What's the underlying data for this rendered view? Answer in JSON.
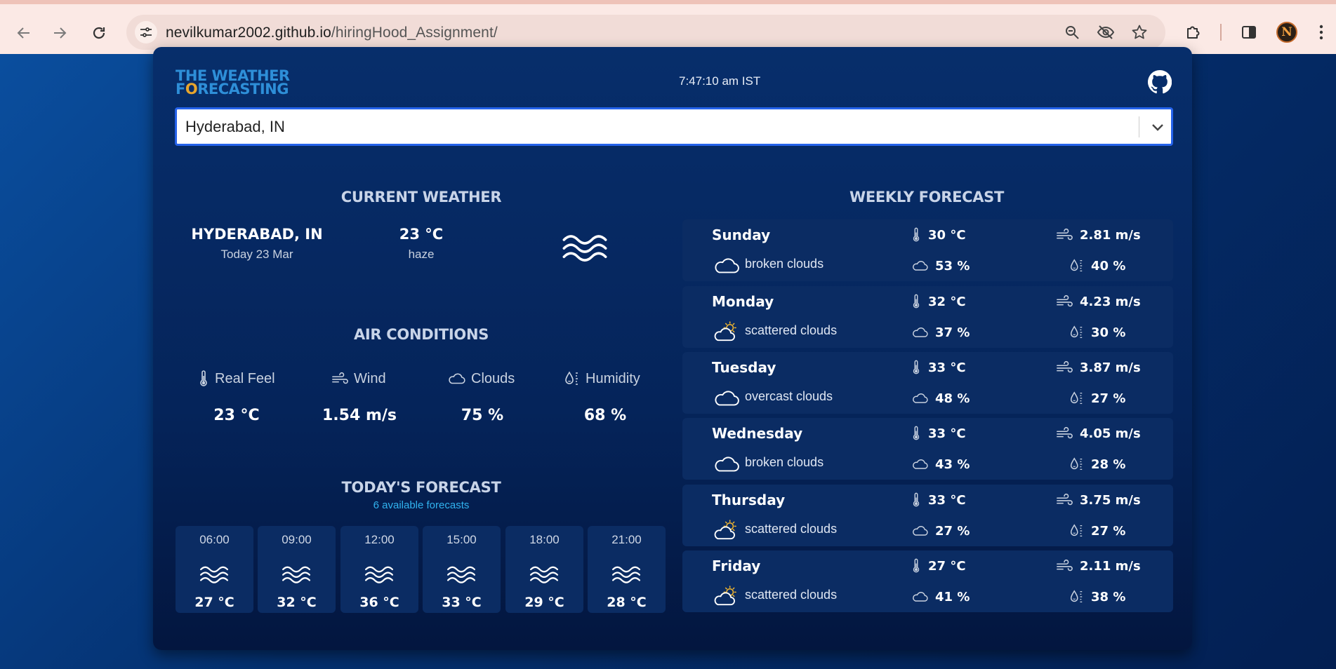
{
  "browser": {
    "url_host": "nevilkumar2002.github.io",
    "url_path": "/hiringHood_Assignment/",
    "avatar_letter": "N",
    "icons": [
      "back-icon",
      "forward-icon",
      "reload-icon",
      "site-info-icon",
      "zoom-icon",
      "eye-off-icon",
      "bookmark-star-icon",
      "extensions-icon",
      "sidebar-icon",
      "more-icon"
    ]
  },
  "header": {
    "logo_line1": "THE WEATHER",
    "logo_line2_f": "F",
    "logo_line2_o": "O",
    "logo_line2_rest": "RECASTING",
    "clock": "7:47:10 am IST"
  },
  "search": {
    "value": "Hyderabad, IN"
  },
  "current": {
    "title": "CURRENT WEATHER",
    "city": "HYDERABAD, IN",
    "date": "Today 23 Mar",
    "temp": "23 °C",
    "desc": "haze",
    "icon": "haze-icon"
  },
  "air": {
    "title": "AIR CONDITIONS",
    "items": [
      {
        "label": "Real Feel",
        "value": "23 °C",
        "icon": "thermometer-icon"
      },
      {
        "label": "Wind",
        "value": "1.54 m/s",
        "icon": "wind-icon"
      },
      {
        "label": "Clouds",
        "value": "75 %",
        "icon": "cloud-icon"
      },
      {
        "label": "Humidity",
        "value": "68 %",
        "icon": "humidity-icon"
      }
    ]
  },
  "today": {
    "title": "TODAY'S FORECAST",
    "subtitle": "6 available forecasts",
    "items": [
      {
        "time": "06:00",
        "temp": "27 °C"
      },
      {
        "time": "09:00",
        "temp": "32 °C"
      },
      {
        "time": "12:00",
        "temp": "36 °C"
      },
      {
        "time": "15:00",
        "temp": "33 °C"
      },
      {
        "time": "18:00",
        "temp": "29 °C"
      },
      {
        "time": "21:00",
        "temp": "28 °C"
      }
    ]
  },
  "weekly": {
    "title": "WEEKLY FORECAST",
    "days": [
      {
        "day": "Sunday",
        "desc": "broken clouds",
        "icon": "cloud-icon",
        "temp": "30 °C",
        "wind": "2.81 m/s",
        "clouds": "53 %",
        "humidity": "40 %"
      },
      {
        "day": "Monday",
        "desc": "scattered clouds",
        "icon": "sun-cloud-icon",
        "temp": "32 °C",
        "wind": "4.23 m/s",
        "clouds": "37 %",
        "humidity": "30 %"
      },
      {
        "day": "Tuesday",
        "desc": "overcast clouds",
        "icon": "cloud-icon",
        "temp": "33 °C",
        "wind": "3.87 m/s",
        "clouds": "48 %",
        "humidity": "27 %"
      },
      {
        "day": "Wednesday",
        "desc": "broken clouds",
        "icon": "cloud-icon",
        "temp": "33 °C",
        "wind": "4.05 m/s",
        "clouds": "43 %",
        "humidity": "28 %"
      },
      {
        "day": "Thursday",
        "desc": "scattered clouds",
        "icon": "sun-cloud-icon",
        "temp": "33 °C",
        "wind": "3.75 m/s",
        "clouds": "27 %",
        "humidity": "27 %"
      },
      {
        "day": "Friday",
        "desc": "scattered clouds",
        "icon": "sun-cloud-icon",
        "temp": "27 °C",
        "wind": "2.11 m/s",
        "clouds": "41 %",
        "humidity": "38 %"
      }
    ]
  }
}
